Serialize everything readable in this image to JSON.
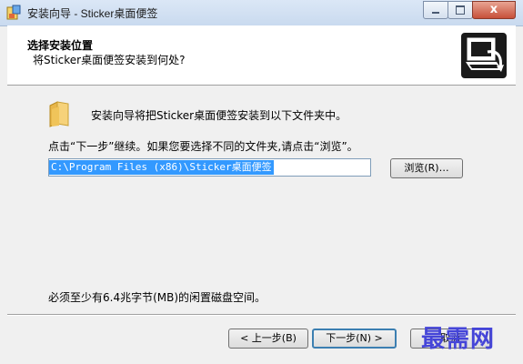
{
  "window": {
    "title": "安装向导 - Sticker桌面便签",
    "close_symbol": "x"
  },
  "header": {
    "title": "选择安装位置",
    "subtitle": "将Sticker桌面便签安装到何处?"
  },
  "main": {
    "description": "安装向导将把Sticker桌面便签安装到以下文件夹中。",
    "instruction": "点击“下一步”继续。如果您要选择不同的文件夹,请点击“浏览”。",
    "install_path": "C:\\Program Files (x86)\\Sticker桌面便签",
    "browse_label": "浏览(R)…",
    "space_required": "必须至少有6.4兆字节(MB)的闲置磁盘空间。"
  },
  "buttons": {
    "back": "< 上一步(B)",
    "next": "下一步(N) >",
    "cancel": "取消"
  },
  "watermark": "最需网",
  "colors": {
    "selection": "#3399ff",
    "titlebar": "#c9daef",
    "close_button": "#c7503a"
  }
}
